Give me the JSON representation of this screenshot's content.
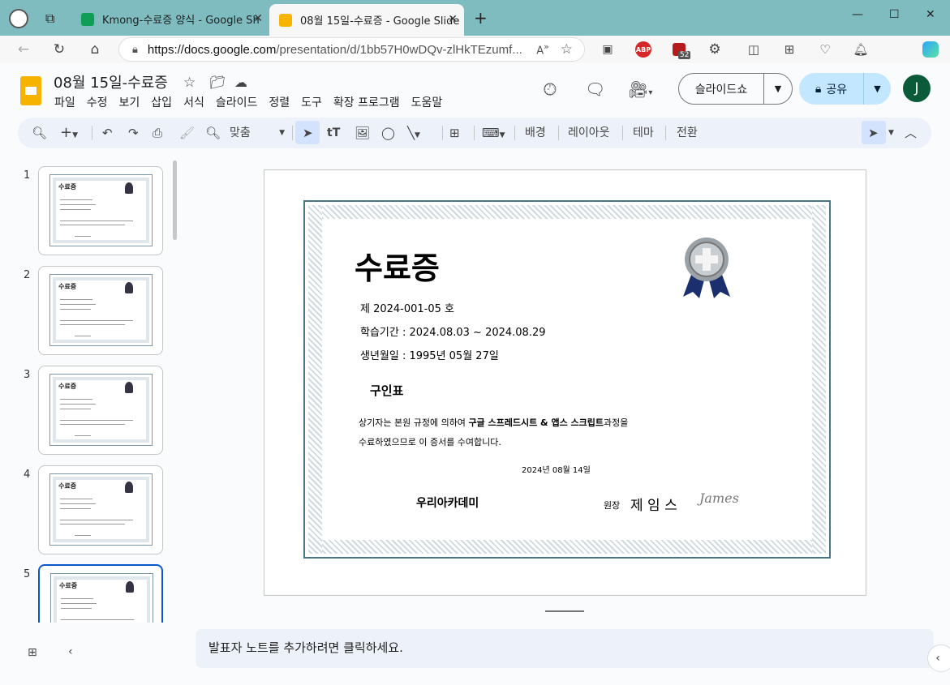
{
  "browser": {
    "tabs": [
      {
        "title": "Kmong-수료증 양식 - Google Sh",
        "icon": "sheets-icon"
      },
      {
        "title": "08월 15일-수료증 - Google Slide",
        "icon": "slides-icon"
      }
    ],
    "url_host": "https://docs.google.com",
    "url_path": "/presentation/d/1bb57H0wDQv-zlHkTEzumf...",
    "badge_abp": "ABP",
    "badge_count": "52"
  },
  "doc": {
    "title": "08월 15일-수료증",
    "menu": [
      "파일",
      "수정",
      "보기",
      "삽입",
      "서식",
      "슬라이드",
      "정렬",
      "도구",
      "확장 프로그램",
      "도움말"
    ],
    "slideshow_label": "슬라이드쇼",
    "share_label": "공유",
    "avatar_letter": "J"
  },
  "toolbar": {
    "zoom_label": "맞춤",
    "background_label": "배경",
    "layout_label": "레이아웃",
    "theme_label": "테마",
    "transition_label": "전환"
  },
  "filmstrip": {
    "numbers": [
      "1",
      "2",
      "3",
      "4",
      "5"
    ],
    "thumb_title": "수료증",
    "selected": 5
  },
  "certificate": {
    "title": "수료증",
    "number_line": "제 2024-001-05 호",
    "period_line": "학습기간 : 2024.08.03 ~ 2024.08.29",
    "birth_line": "생년월일 : 1995년 05월 27일",
    "name": "구인표",
    "body_prefix": "상기자는 본원 규정에  의하여 ",
    "body_course": "구글 스프레드시트 & 앱스 스크립트",
    "body_suffix": "과정을",
    "body_line2": "수료하였으므로 이 증서를 수여합니다.",
    "date": "2024년 08월 14일",
    "academy": "우리아카데미",
    "director_title": "원장",
    "director_name": "제 임 스",
    "signature": "James"
  },
  "notes": {
    "placeholder": "발표자 노트를 추가하려면 클릭하세요."
  }
}
